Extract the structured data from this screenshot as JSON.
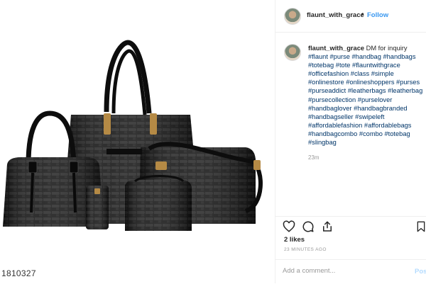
{
  "post": {
    "username": "flaunt_with_grace",
    "follow_label": "Follow",
    "separator": "•",
    "more_label": "…"
  },
  "photo": {
    "alt": "Black crocodile-pattern leather handbag set",
    "watermark": "1810327"
  },
  "caption": {
    "username": "flaunt_with_grace",
    "text": "DM for inquiry",
    "hashtags": "#flaunt #purse #handbag #handbags #totebag #tote #flauntwithgrace #officefashion #class #simple #onlinestore #onlineshoppers #purses #purseaddict #leatherbags #leatherbag #pursecollection #purselover #handbaglover #handbagbranded #handbagseller #swipeleft #affordablefashion #affordablebags #handbagcombo #combo #totebag #slingbag",
    "time": "23m"
  },
  "engagement": {
    "likes": "2 likes",
    "ago": "23 MINUTES AGO"
  },
  "comment": {
    "placeholder": "Add a comment...",
    "post_label": "Post"
  },
  "icons": [
    "more-icon",
    "heart-icon",
    "comment-icon",
    "share-icon",
    "bookmark-icon"
  ]
}
